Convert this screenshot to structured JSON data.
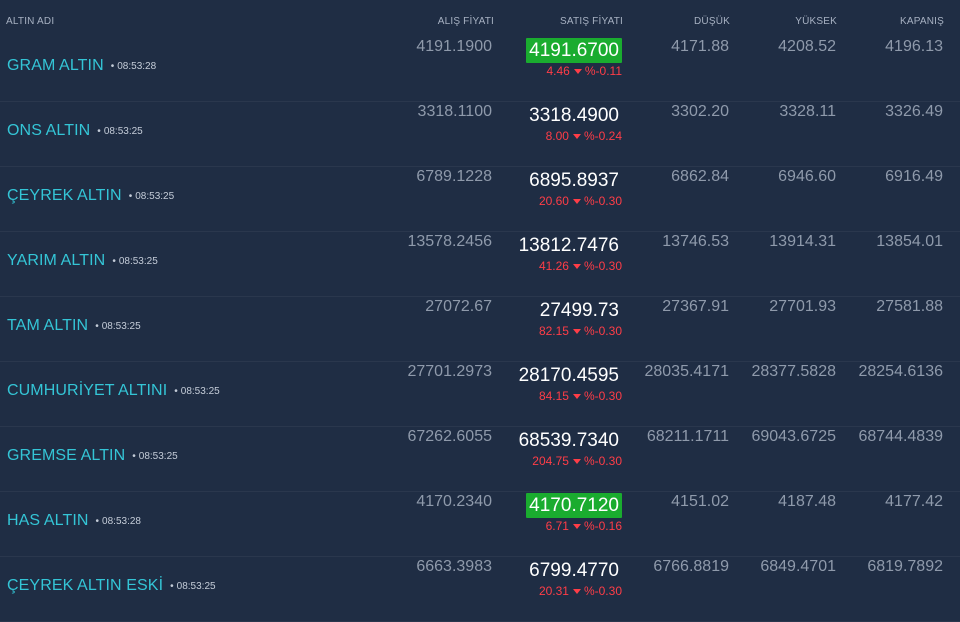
{
  "headers": {
    "name": "ALTIN ADI",
    "buy": "ALIŞ FİYATI",
    "sell": "SATIŞ FİYATI",
    "low": "DÜŞÜK",
    "high": "YÜKSEK",
    "close": "KAPANIŞ"
  },
  "colors": {
    "background": "#1f2d44",
    "name": "#34c5d6",
    "up_highlight": "#1aac2f",
    "down": "#ff3d47"
  },
  "rows": [
    {
      "name": "GRAM ALTIN",
      "time": "08:53:28",
      "buy": "4191.1900",
      "sell": "4191.6700",
      "highlight": true,
      "change": "4.46",
      "pct": "%-0.11",
      "low": "4171.88",
      "high": "4208.52",
      "close": "4196.13"
    },
    {
      "name": "ONS ALTIN",
      "time": "08:53:25",
      "buy": "3318.1100",
      "sell": "3318.4900",
      "highlight": false,
      "change": "8.00",
      "pct": "%-0.24",
      "low": "3302.20",
      "high": "3328.11",
      "close": "3326.49"
    },
    {
      "name": "ÇEYREK ALTIN",
      "time": "08:53:25",
      "buy": "6789.1228",
      "sell": "6895.8937",
      "highlight": false,
      "change": "20.60",
      "pct": "%-0.30",
      "low": "6862.84",
      "high": "6946.60",
      "close": "6916.49"
    },
    {
      "name": "YARIM ALTIN",
      "time": "08:53:25",
      "buy": "13578.2456",
      "sell": "13812.7476",
      "highlight": false,
      "change": "41.26",
      "pct": "%-0.30",
      "low": "13746.53",
      "high": "13914.31",
      "close": "13854.01"
    },
    {
      "name": "TAM ALTIN",
      "time": "08:53:25",
      "buy": "27072.67",
      "sell": "27499.73",
      "highlight": false,
      "change": "82.15",
      "pct": "%-0.30",
      "low": "27367.91",
      "high": "27701.93",
      "close": "27581.88"
    },
    {
      "name": "CUMHURİYET ALTINI",
      "time": "08:53:25",
      "buy": "27701.2973",
      "sell": "28170.4595",
      "highlight": false,
      "change": "84.15",
      "pct": "%-0.30",
      "low": "28035.4171",
      "high": "28377.5828",
      "close": "28254.6136"
    },
    {
      "name": "GREMSE ALTIN",
      "time": "08:53:25",
      "buy": "67262.6055",
      "sell": "68539.7340",
      "highlight": false,
      "change": "204.75",
      "pct": "%-0.30",
      "low": "68211.1711",
      "high": "69043.6725",
      "close": "68744.4839"
    },
    {
      "name": "HAS ALTIN",
      "time": "08:53:28",
      "buy": "4170.2340",
      "sell": "4170.7120",
      "highlight": true,
      "change": "6.71",
      "pct": "%-0.16",
      "low": "4151.02",
      "high": "4187.48",
      "close": "4177.42"
    },
    {
      "name": "ÇEYREK ALTIN ESKİ",
      "time": "08:53:25",
      "buy": "6663.3983",
      "sell": "6799.4770",
      "highlight": false,
      "change": "20.31",
      "pct": "%-0.30",
      "low": "6766.8819",
      "high": "6849.4701",
      "close": "6819.7892"
    }
  ]
}
